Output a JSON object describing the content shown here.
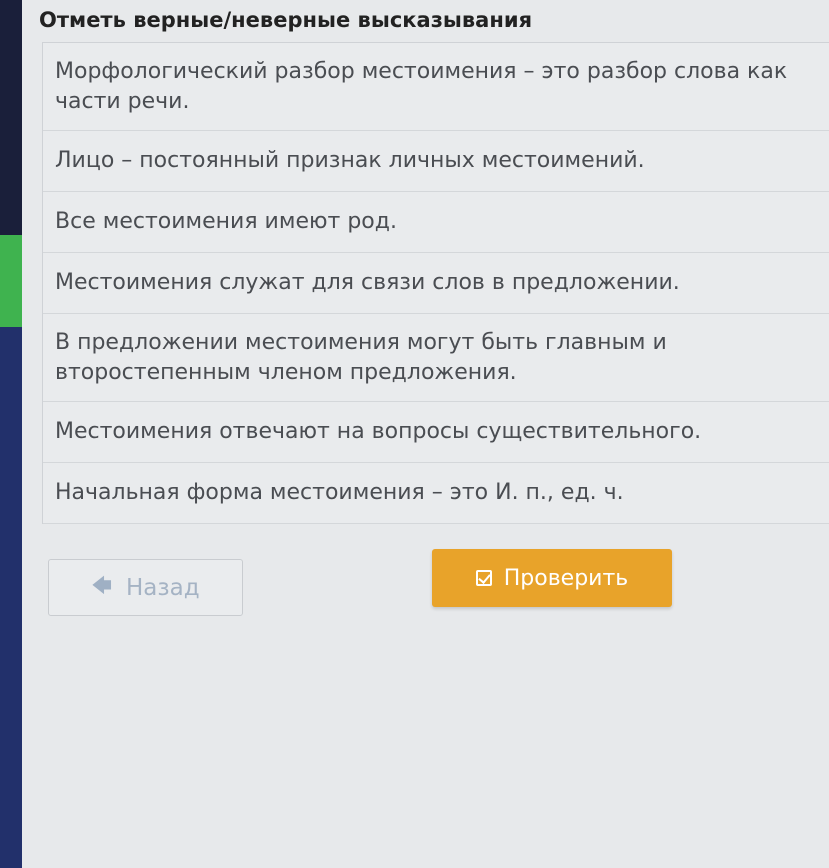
{
  "task": {
    "title": "Отметь верные/неверные высказывания"
  },
  "statements": [
    {
      "text": "Морфологический разбор местоимения – это разбор слова как части речи."
    },
    {
      "text": "Лицо – постоянный признак личных местоимений."
    },
    {
      "text": "Все местоимения имеют род."
    },
    {
      "text": "Местоимения служат для связи слов в предложении."
    },
    {
      "text": "В предложении местоимения могут быть главным и второстепенным членом предложения."
    },
    {
      "text": "Местоимения отвечают на вопросы существительного."
    },
    {
      "text": "Начальная форма местоимения – это И. п., ед. ч."
    }
  ],
  "buttons": {
    "back_label": "Назад",
    "check_label": "Проверить"
  },
  "icons": {
    "back": "arrow-left-icon",
    "check": "checkbox-check-icon"
  },
  "colors": {
    "accent": "#e8a32a",
    "sidebar_green": "#3fb34f",
    "sidebar_blue": "#22306b"
  }
}
